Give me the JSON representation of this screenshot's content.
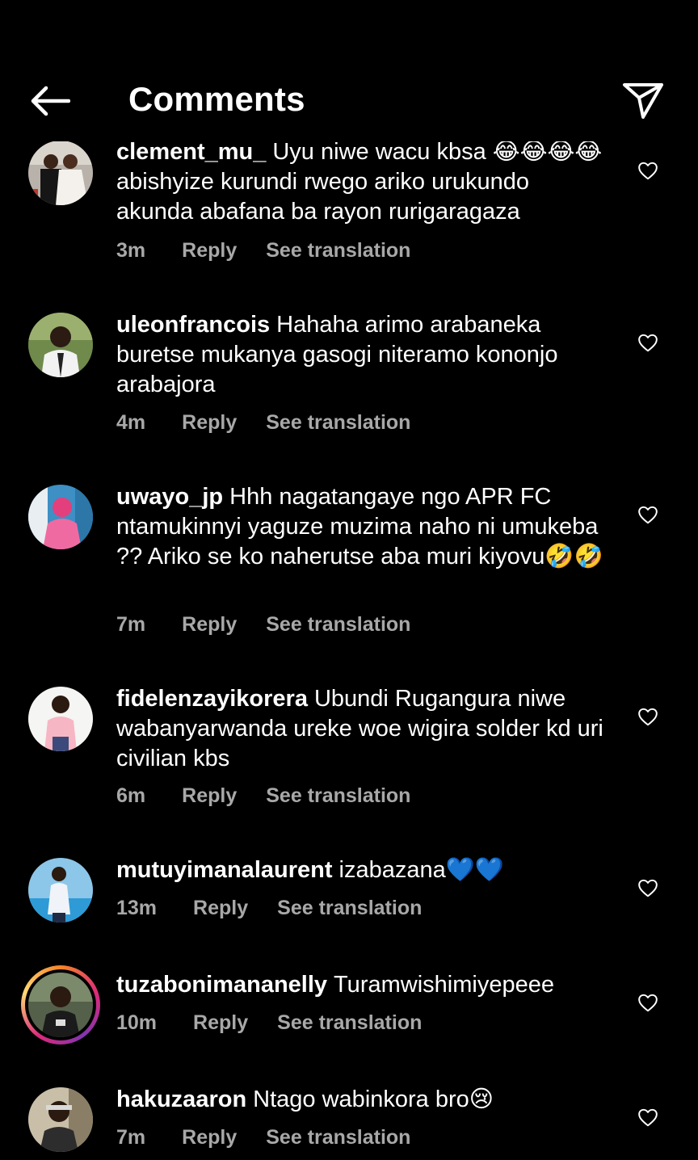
{
  "header": {
    "title": "Comments"
  },
  "icons": {
    "back": "arrow-left-icon",
    "share": "paper-plane-icon",
    "like": "heart-outline-icon"
  },
  "colors": {
    "background": "#000000",
    "text": "#ffffff",
    "meta": "#a8a8a8",
    "story_ring": "#dd2a7b"
  },
  "comments": [
    {
      "username": "clement_mu_",
      "text": "Uyu niwe wacu kbsa 😂😂😂😂 abishyize kurundi rwego ariko urukundo akunda abafana ba rayon rurigaragaza",
      "time": "3m",
      "reply": "Reply",
      "translate": "See translation"
    },
    {
      "username": "uleonfrancois",
      "text": "Hahaha arimo arabaneka buretse mukanya gasogi niteramo kononjo arabajora",
      "time": "4m",
      "reply": "Reply",
      "translate": "See translation"
    },
    {
      "username": "uwayo_jp",
      "text": "Hhh nagatangaye ngo APR FC ntamukinnyi yaguze muzima naho ni umukeba ?? Ariko se ko naherutse aba muri kiyovu🤣🤣",
      "time": "7m",
      "reply": "Reply",
      "translate": "See translation"
    },
    {
      "username": "fidelenzayikorera",
      "text": "Ubundi Rugangura niwe wabanyarwanda ureke woe wigira solder kd uri civilian kbs",
      "time": "6m",
      "reply": "Reply",
      "translate": "See translation"
    },
    {
      "username": "mutuyimanalaurent",
      "text": "izabazana💙💙",
      "time": "13m",
      "reply": "Reply",
      "translate": "See translation"
    },
    {
      "username": "tuzabonimananelly",
      "text": "Turamwishimiyepeee",
      "time": "10m",
      "reply": "Reply",
      "translate": "See translation"
    },
    {
      "username": "hakuzaaron",
      "text": "Ntago wabinkora bro😢",
      "time": "7m",
      "reply": "Reply",
      "translate": "See translation"
    }
  ]
}
